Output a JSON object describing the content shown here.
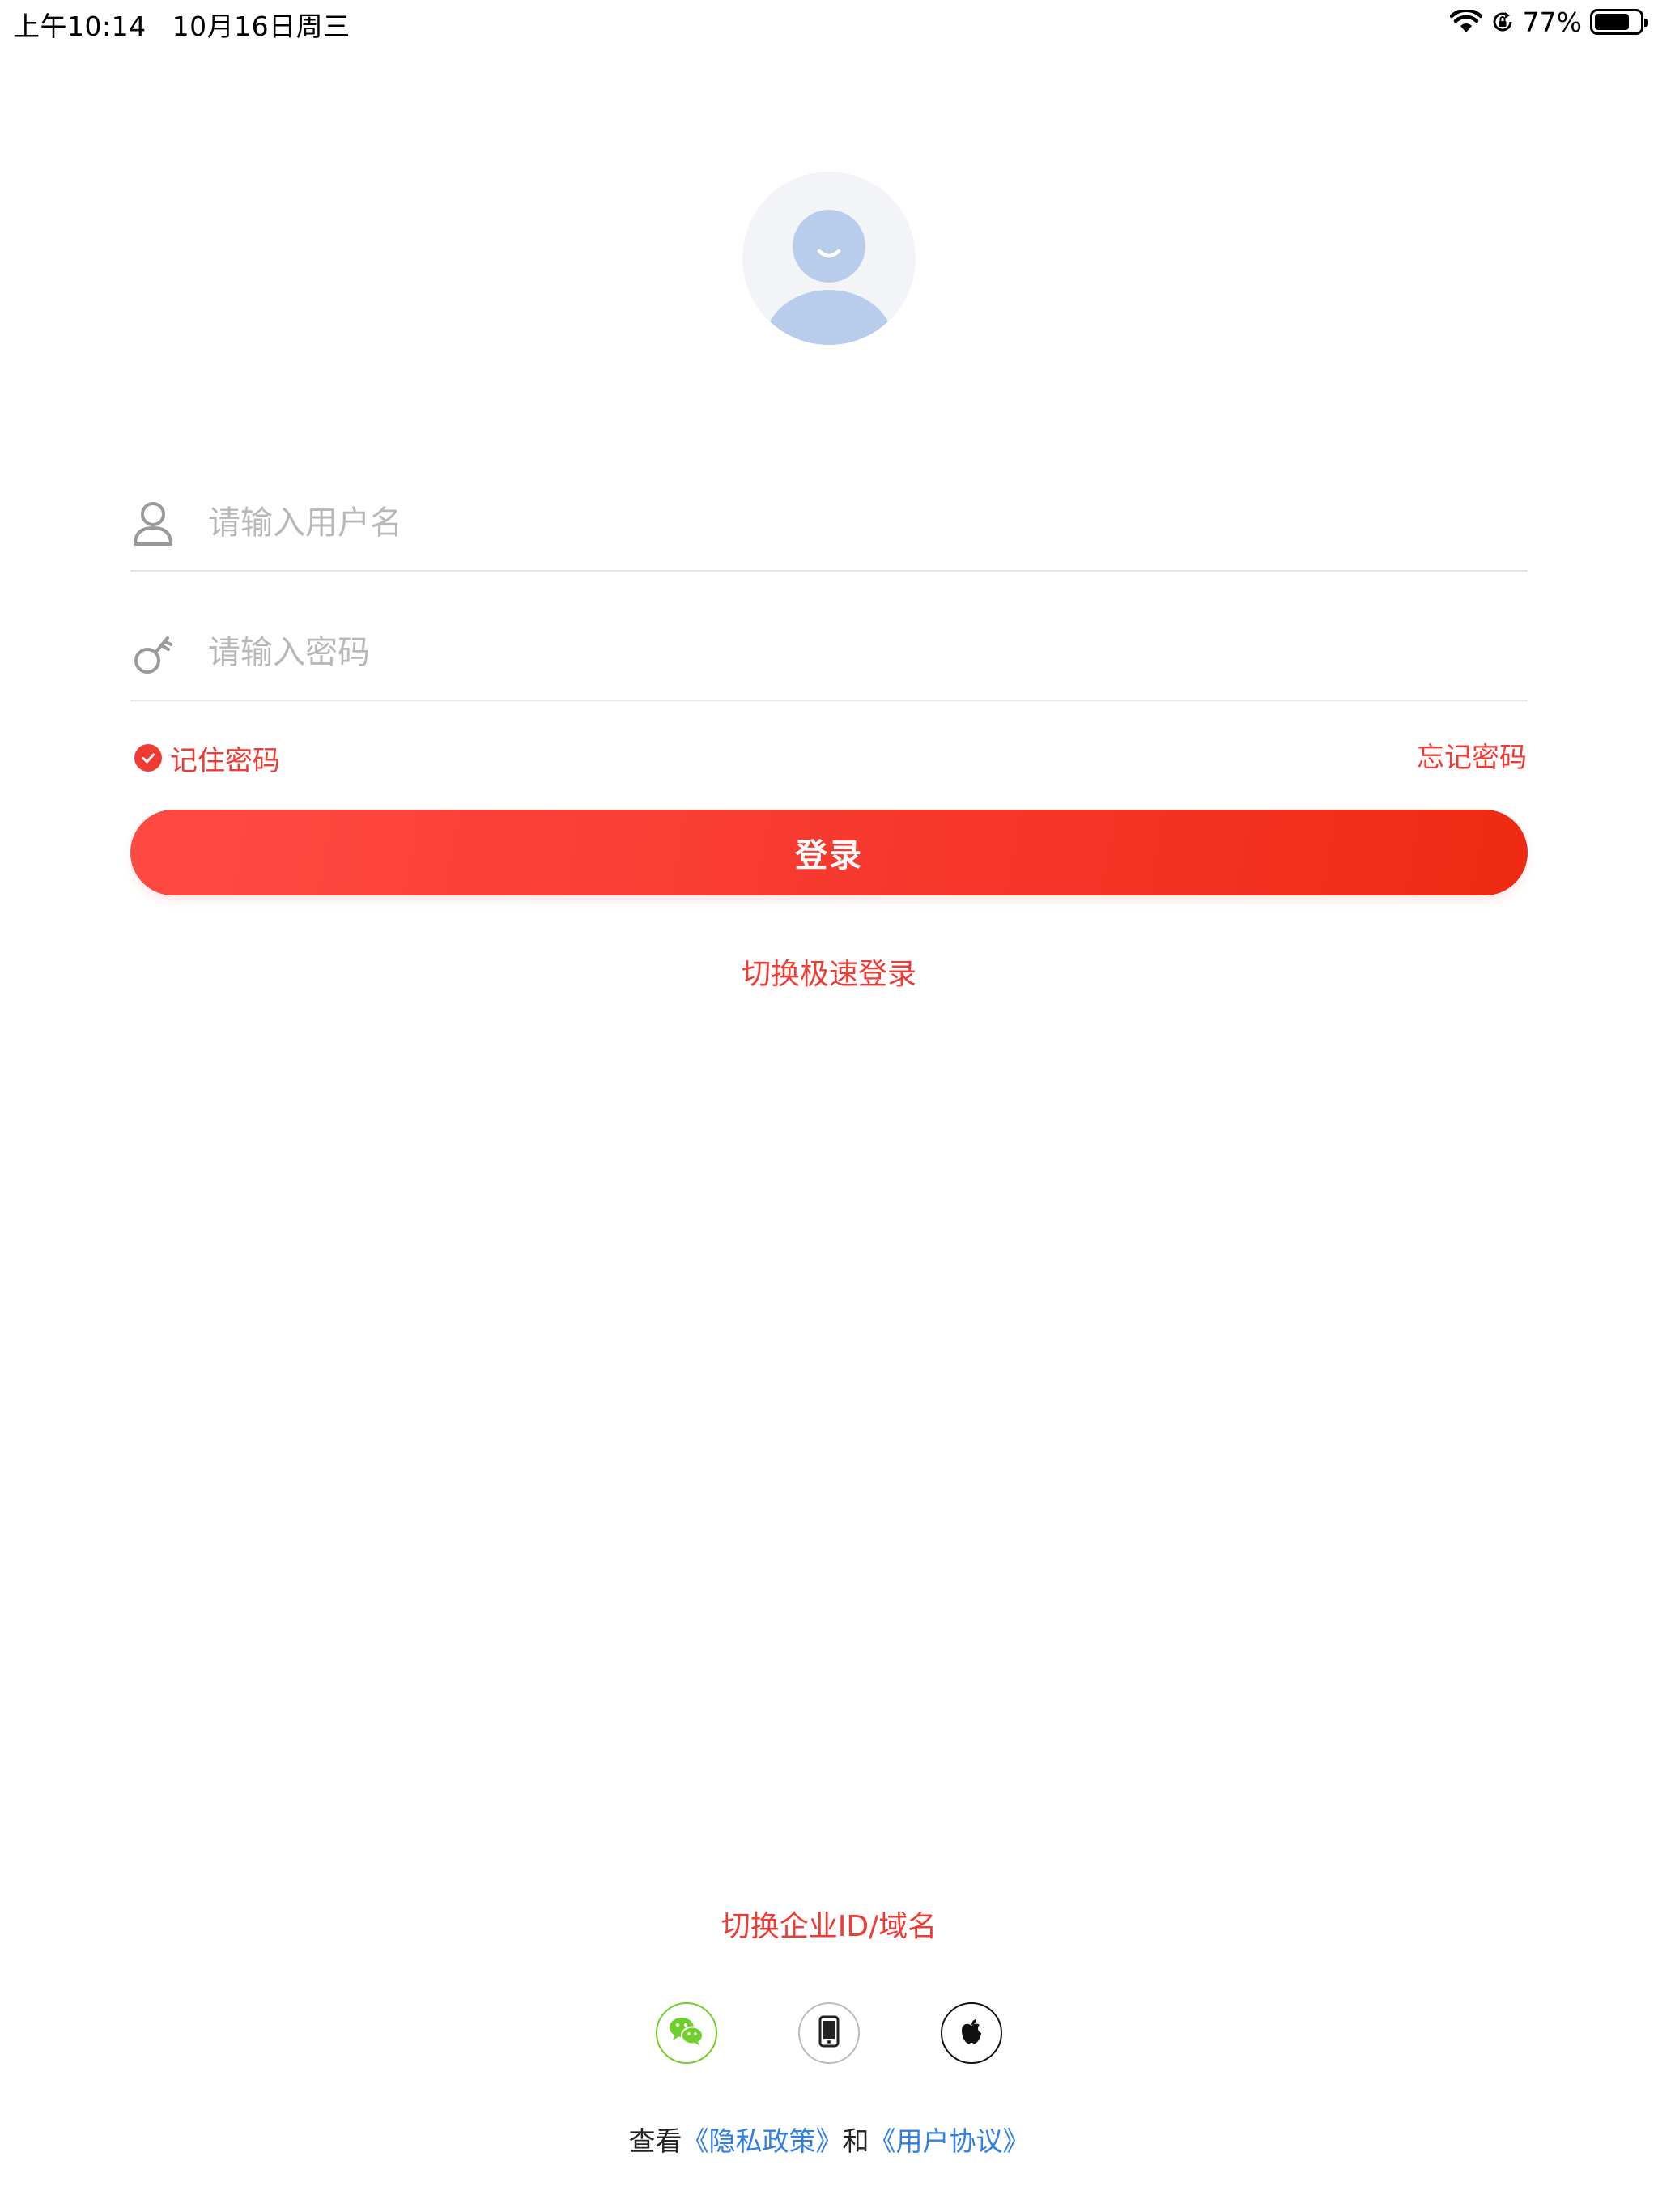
{
  "status_bar": {
    "time": "上午10:14",
    "date": "10月16日周三",
    "battery_percent": "77%",
    "battery_level": 0.77,
    "icons": [
      "wifi-icon",
      "orientation-lock-icon",
      "battery-icon"
    ]
  },
  "avatar": {
    "icon": "default-avatar-icon"
  },
  "login_form": {
    "username_placeholder": "请输入用户名",
    "username_value": "",
    "username_icon": "user-icon",
    "password_placeholder": "请输入密码",
    "password_value": "",
    "password_icon": "key-icon",
    "remember_label": "记住密码",
    "remember_checked": true,
    "forgot_label": "忘记密码",
    "login_button": "登录",
    "switch_fast_login": "切换极速登录"
  },
  "footer": {
    "switch_enterprise": "切换企业ID/域名",
    "third_party": [
      {
        "name": "wechat",
        "icon": "wechat-icon"
      },
      {
        "name": "phone",
        "icon": "phone-icon"
      },
      {
        "name": "apple",
        "icon": "apple-icon"
      }
    ],
    "policy_prefix": "查看",
    "privacy_policy": "《隐私政策》",
    "policy_and": "和",
    "user_agreement": "《用户协议》"
  },
  "colors": {
    "accent": "#ef3b33",
    "link_blue": "#2f7fe6",
    "wechat_green": "#6fd02b",
    "avatar_blue": "#b8cdec"
  }
}
